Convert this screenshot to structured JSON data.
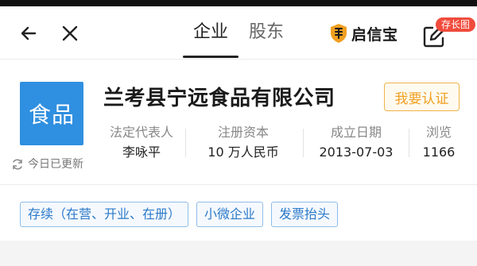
{
  "header": {
    "tabs": [
      {
        "label": "企业",
        "active": true
      },
      {
        "label": "股东",
        "active": false
      }
    ],
    "brand_name": "启信宝",
    "save_badge": "存长图"
  },
  "company": {
    "logo_text": "食品",
    "name": "兰考县宁远食品有限公司",
    "certify_button": "我要认证",
    "info": [
      {
        "label": "法定代表人",
        "value": "李咏平"
      },
      {
        "label": "注册资本",
        "value": "10 万人民币"
      },
      {
        "label": "成立日期",
        "value": "2013-07-03"
      },
      {
        "label": "浏览",
        "value": "1166"
      }
    ],
    "updated_text": "今日已更新"
  },
  "tags": [
    "存续（在营、开业、在册）",
    "小微企业",
    "发票抬头"
  ],
  "colors": {
    "logo_bg": "#2f8fe0",
    "certify": "#f0a020",
    "tag_text": "#2b79c8",
    "badge": "#f04b3c"
  },
  "icons": {
    "back": "arrow-left-icon",
    "close": "close-icon",
    "brand": "qixinbao-logo-icon",
    "save": "edit-share-icon",
    "refresh": "refresh-icon"
  }
}
